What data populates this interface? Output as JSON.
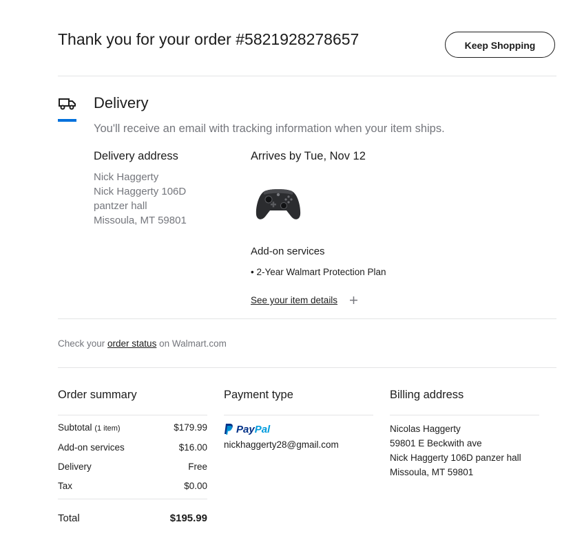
{
  "header": {
    "title": "Thank you for your order #5821928278657",
    "keep_shopping": "Keep Shopping"
  },
  "delivery": {
    "icon": "truck-icon",
    "heading": "Delivery",
    "note": "You'll receive an email with tracking information when your item ships.",
    "address_heading": "Delivery address",
    "address_lines": [
      "Nick Haggerty",
      "Nick Haggerty 106D",
      "pantzer hall",
      "Missoula, MT 59801"
    ],
    "arrives": "Arrives by Tue, Nov 12",
    "item_image": "xbox-controller-image",
    "addon_heading": "Add-on services",
    "addon_item": "• 2-Year Walmart Protection Plan",
    "details_link": "See your item details",
    "details_icon": "plus-icon",
    "accent_color": "#0071dc"
  },
  "status": {
    "prefix": "Check your ",
    "link": "order status",
    "suffix": " on Walmart.com"
  },
  "order_summary": {
    "heading": "Order summary",
    "rows": [
      {
        "label": "Subtotal",
        "sub": "(1 item)",
        "value": "$179.99"
      },
      {
        "label": "Add-on services",
        "sub": "",
        "value": "$16.00"
      },
      {
        "label": "Delivery",
        "sub": "",
        "value": "Free"
      },
      {
        "label": "Tax",
        "sub": "",
        "value": "$0.00"
      }
    ],
    "total_label": "Total",
    "total_value": "$195.99"
  },
  "payment": {
    "heading": "Payment type",
    "method": "PayPal",
    "email": "nickhaggerty28@gmail.com"
  },
  "billing": {
    "heading": "Billing address",
    "lines": [
      "Nicolas Haggerty",
      "59801 E Beckwith ave",
      "Nick Haggerty 106D panzer hall",
      "Missoula, MT 59801"
    ]
  }
}
